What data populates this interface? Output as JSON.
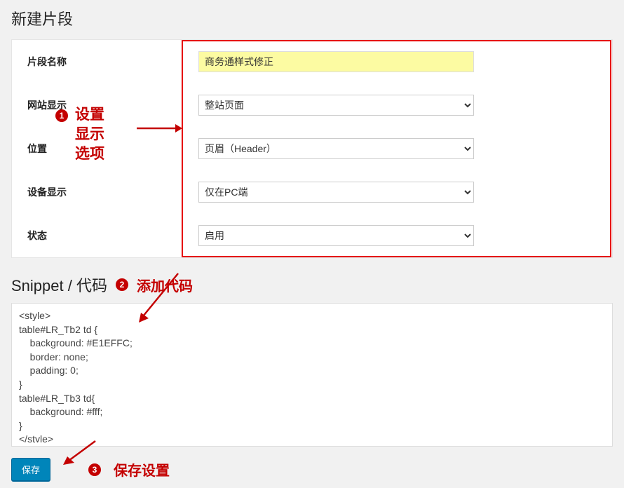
{
  "page_title": "新建片段",
  "form": {
    "name": {
      "label": "片段名称",
      "value": "商务通样式修正"
    },
    "site_display": {
      "label": "网站显示",
      "value": "整站页面"
    },
    "position": {
      "label": "位置",
      "value": "页眉（Header）"
    },
    "device_display": {
      "label": "设备显示",
      "value": "仅在PC端"
    },
    "status": {
      "label": "状态",
      "value": "启用"
    }
  },
  "annotations": {
    "badge1": "1",
    "anno1_line1": "设置",
    "anno1_line2": "显示",
    "anno1_line3": "选项",
    "badge2": "2",
    "anno2": "添加代码",
    "badge3": "3",
    "anno3": "保存设置"
  },
  "snippet": {
    "title": "Snippet / 代码",
    "code": "<style>\ntable#LR_Tb2 td {\n    background: #E1EFFC;\n    border: none;\n    padding: 0;\n}\ntable#LR_Tb3 td{\n    background: #fff;\n}\n</style>"
  },
  "save_button": "保存"
}
